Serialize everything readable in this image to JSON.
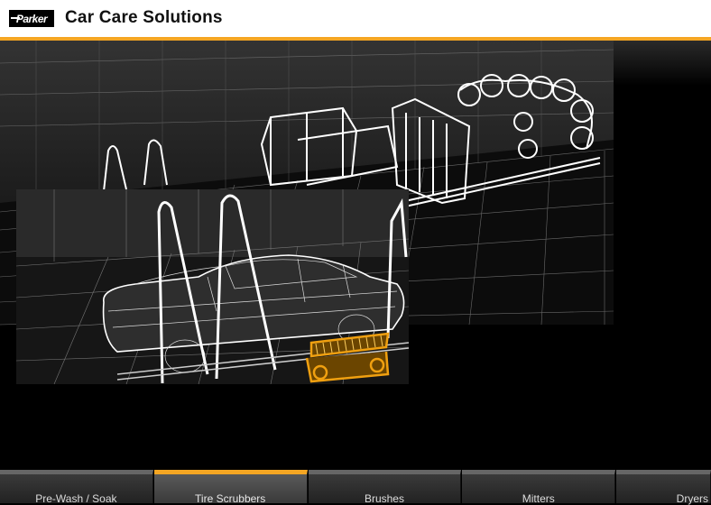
{
  "header": {
    "logo_text": "Parker",
    "title": "Car Care Solutions"
  },
  "tabs": [
    {
      "label": "Pre-Wash / Soak",
      "active": false
    },
    {
      "label": "Tire Scrubbers",
      "active": true
    },
    {
      "label": "Brushes",
      "active": false
    },
    {
      "label": "Mitters",
      "active": false
    },
    {
      "label": "Dryers",
      "active": false
    }
  ],
  "colors": {
    "accent": "#f5a623",
    "highlight": "#f0a010",
    "wireframe": "#ffffff",
    "background": "#000000"
  },
  "icons": {
    "logo": "parker-logo-icon"
  }
}
